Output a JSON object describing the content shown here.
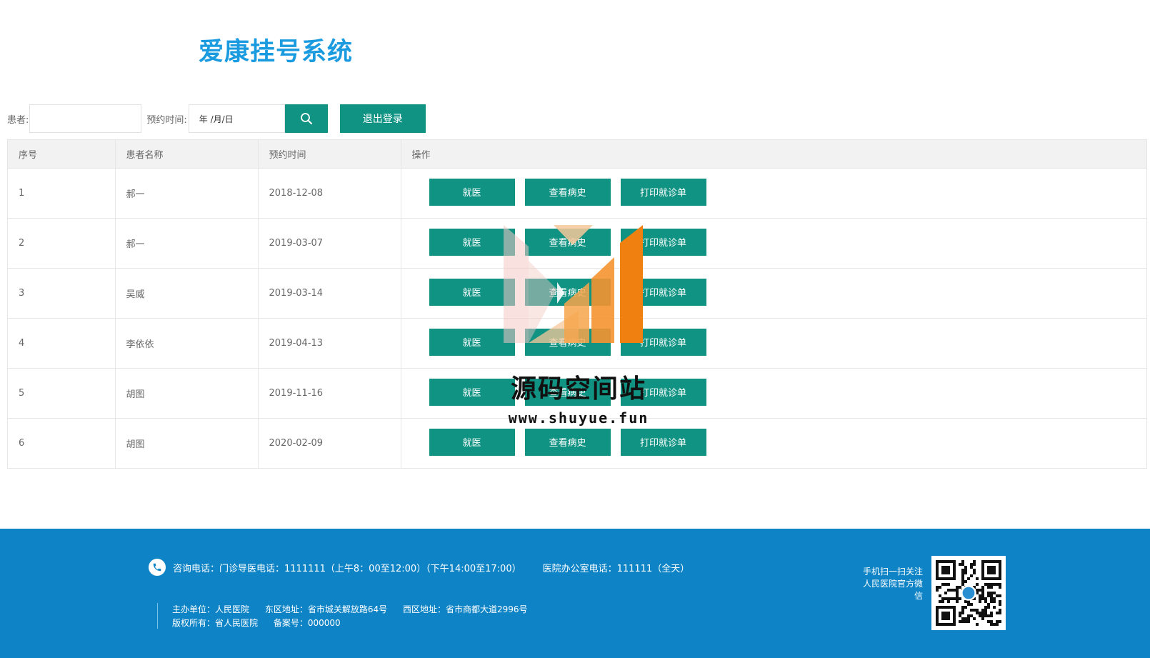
{
  "header": {
    "title": "爱康挂号系统"
  },
  "search": {
    "patient_label": "患者:",
    "patient_value": "",
    "date_label": "预约时间:",
    "date_value": "年 /月/日",
    "logout_label": "退出登录"
  },
  "table": {
    "headers": [
      "序号",
      "患者名称",
      "预约时间",
      "操作"
    ],
    "rows": [
      {
        "id": "1",
        "name": "郝一",
        "date": "2018-12-08"
      },
      {
        "id": "2",
        "name": "郝一",
        "date": "2019-03-07"
      },
      {
        "id": "3",
        "name": "吴威",
        "date": "2019-03-14"
      },
      {
        "id": "4",
        "name": "李依依",
        "date": "2019-04-13"
      },
      {
        "id": "5",
        "name": "胡图",
        "date": "2019-11-16"
      },
      {
        "id": "6",
        "name": "胡图",
        "date": "2020-02-09"
      }
    ],
    "actions": {
      "treat": "就医",
      "history": "查看病史",
      "print": "打印就诊单"
    }
  },
  "watermark": {
    "text": "源码空间站",
    "url": "www.shuyue.fun"
  },
  "footer": {
    "phone_outpatient": "咨询电话：门诊导医电话：1111111（上午8：00至12:00）（下午14:00至17:00）",
    "phone_office": "医院办公室电话：111111（全天）",
    "sponsor": "主办单位：人民医院",
    "east_address": "东区地址：省市城关解放路64号",
    "west_address": "西区地址：省市商都大道2996号",
    "copyright": "版权所有：省人民医院",
    "icp": "备案号：000000",
    "qr_caption": "手机扫一扫关注人民医院官方微信"
  },
  "colors": {
    "primary": "#109383",
    "brand": "#1a9be0",
    "footer": "#0e84c7"
  },
  "icons": {
    "search": "search-icon",
    "phone": "phone-icon",
    "qr": "qr-code-icon"
  }
}
